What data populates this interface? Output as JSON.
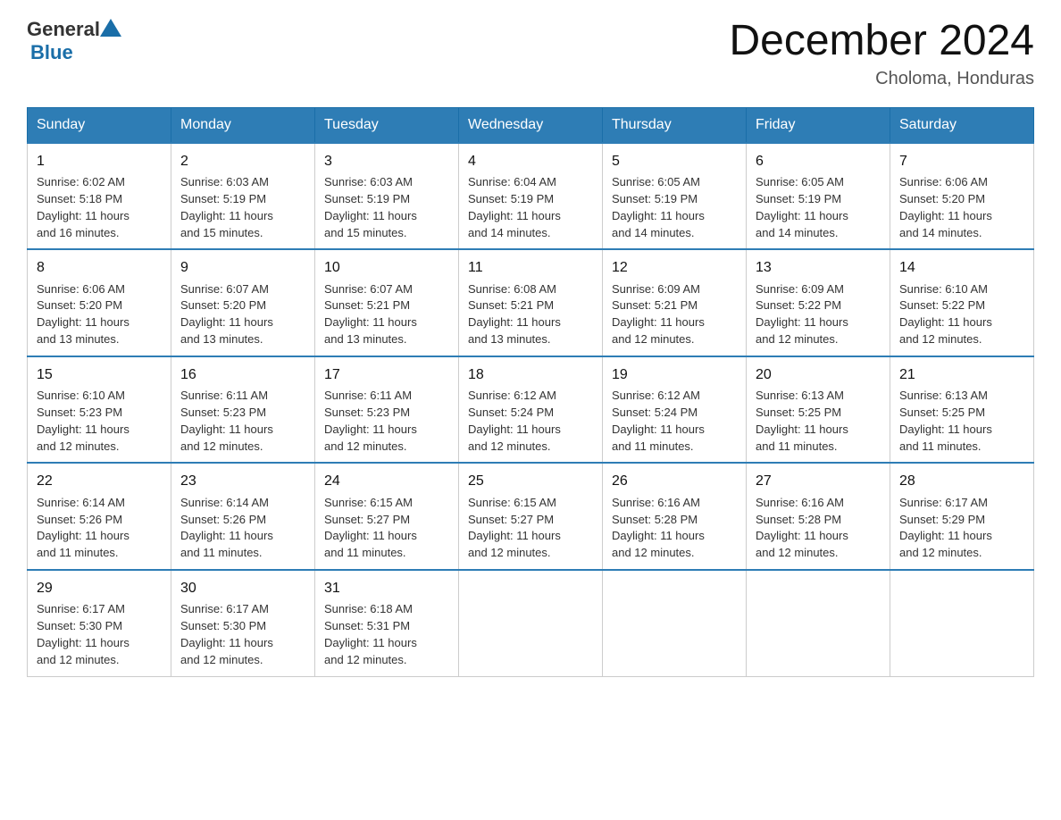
{
  "logo": {
    "general": "General",
    "blue": "Blue"
  },
  "title": "December 2024",
  "subtitle": "Choloma, Honduras",
  "headers": [
    "Sunday",
    "Monday",
    "Tuesday",
    "Wednesday",
    "Thursday",
    "Friday",
    "Saturday"
  ],
  "weeks": [
    [
      {
        "day": "1",
        "sunrise": "6:02 AM",
        "sunset": "5:18 PM",
        "daylight": "11 hours and 16 minutes."
      },
      {
        "day": "2",
        "sunrise": "6:03 AM",
        "sunset": "5:19 PM",
        "daylight": "11 hours and 15 minutes."
      },
      {
        "day": "3",
        "sunrise": "6:03 AM",
        "sunset": "5:19 PM",
        "daylight": "11 hours and 15 minutes."
      },
      {
        "day": "4",
        "sunrise": "6:04 AM",
        "sunset": "5:19 PM",
        "daylight": "11 hours and 14 minutes."
      },
      {
        "day": "5",
        "sunrise": "6:05 AM",
        "sunset": "5:19 PM",
        "daylight": "11 hours and 14 minutes."
      },
      {
        "day": "6",
        "sunrise": "6:05 AM",
        "sunset": "5:19 PM",
        "daylight": "11 hours and 14 minutes."
      },
      {
        "day": "7",
        "sunrise": "6:06 AM",
        "sunset": "5:20 PM",
        "daylight": "11 hours and 14 minutes."
      }
    ],
    [
      {
        "day": "8",
        "sunrise": "6:06 AM",
        "sunset": "5:20 PM",
        "daylight": "11 hours and 13 minutes."
      },
      {
        "day": "9",
        "sunrise": "6:07 AM",
        "sunset": "5:20 PM",
        "daylight": "11 hours and 13 minutes."
      },
      {
        "day": "10",
        "sunrise": "6:07 AM",
        "sunset": "5:21 PM",
        "daylight": "11 hours and 13 minutes."
      },
      {
        "day": "11",
        "sunrise": "6:08 AM",
        "sunset": "5:21 PM",
        "daylight": "11 hours and 13 minutes."
      },
      {
        "day": "12",
        "sunrise": "6:09 AM",
        "sunset": "5:21 PM",
        "daylight": "11 hours and 12 minutes."
      },
      {
        "day": "13",
        "sunrise": "6:09 AM",
        "sunset": "5:22 PM",
        "daylight": "11 hours and 12 minutes."
      },
      {
        "day": "14",
        "sunrise": "6:10 AM",
        "sunset": "5:22 PM",
        "daylight": "11 hours and 12 minutes."
      }
    ],
    [
      {
        "day": "15",
        "sunrise": "6:10 AM",
        "sunset": "5:23 PM",
        "daylight": "11 hours and 12 minutes."
      },
      {
        "day": "16",
        "sunrise": "6:11 AM",
        "sunset": "5:23 PM",
        "daylight": "11 hours and 12 minutes."
      },
      {
        "day": "17",
        "sunrise": "6:11 AM",
        "sunset": "5:23 PM",
        "daylight": "11 hours and 12 minutes."
      },
      {
        "day": "18",
        "sunrise": "6:12 AM",
        "sunset": "5:24 PM",
        "daylight": "11 hours and 12 minutes."
      },
      {
        "day": "19",
        "sunrise": "6:12 AM",
        "sunset": "5:24 PM",
        "daylight": "11 hours and 11 minutes."
      },
      {
        "day": "20",
        "sunrise": "6:13 AM",
        "sunset": "5:25 PM",
        "daylight": "11 hours and 11 minutes."
      },
      {
        "day": "21",
        "sunrise": "6:13 AM",
        "sunset": "5:25 PM",
        "daylight": "11 hours and 11 minutes."
      }
    ],
    [
      {
        "day": "22",
        "sunrise": "6:14 AM",
        "sunset": "5:26 PM",
        "daylight": "11 hours and 11 minutes."
      },
      {
        "day": "23",
        "sunrise": "6:14 AM",
        "sunset": "5:26 PM",
        "daylight": "11 hours and 11 minutes."
      },
      {
        "day": "24",
        "sunrise": "6:15 AM",
        "sunset": "5:27 PM",
        "daylight": "11 hours and 11 minutes."
      },
      {
        "day": "25",
        "sunrise": "6:15 AM",
        "sunset": "5:27 PM",
        "daylight": "11 hours and 12 minutes."
      },
      {
        "day": "26",
        "sunrise": "6:16 AM",
        "sunset": "5:28 PM",
        "daylight": "11 hours and 12 minutes."
      },
      {
        "day": "27",
        "sunrise": "6:16 AM",
        "sunset": "5:28 PM",
        "daylight": "11 hours and 12 minutes."
      },
      {
        "day": "28",
        "sunrise": "6:17 AM",
        "sunset": "5:29 PM",
        "daylight": "11 hours and 12 minutes."
      }
    ],
    [
      {
        "day": "29",
        "sunrise": "6:17 AM",
        "sunset": "5:30 PM",
        "daylight": "11 hours and 12 minutes."
      },
      {
        "day": "30",
        "sunrise": "6:17 AM",
        "sunset": "5:30 PM",
        "daylight": "11 hours and 12 minutes."
      },
      {
        "day": "31",
        "sunrise": "6:18 AM",
        "sunset": "5:31 PM",
        "daylight": "11 hours and 12 minutes."
      },
      null,
      null,
      null,
      null
    ]
  ],
  "labels": {
    "sunrise": "Sunrise:",
    "sunset": "Sunset:",
    "daylight": "Daylight:"
  }
}
